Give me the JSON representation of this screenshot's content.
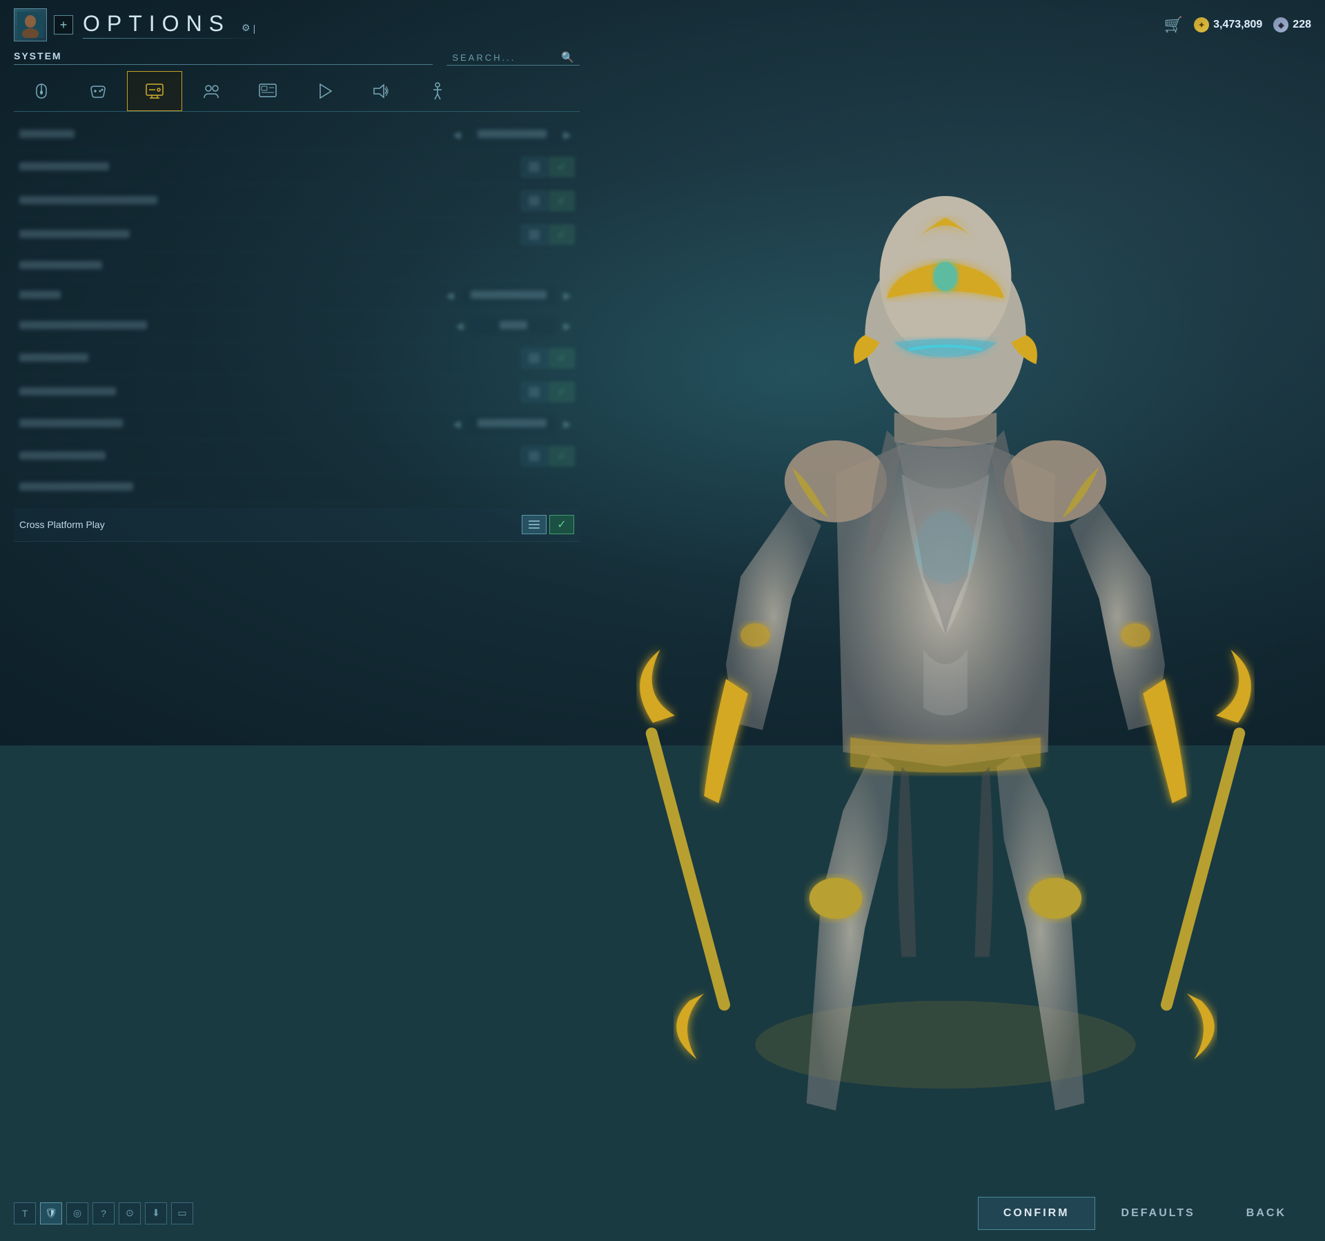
{
  "header": {
    "title": "OPTIONS",
    "add_label": "+",
    "currency1_amount": "3,473,809",
    "currency2_amount": "228"
  },
  "search": {
    "placeholder": "SEARCH..."
  },
  "section_label": "SYSTEM",
  "tabs": [
    {
      "id": "mouse",
      "icon": "🖱",
      "label": "Mouse"
    },
    {
      "id": "controller",
      "icon": "🎮",
      "label": "Controller"
    },
    {
      "id": "display",
      "icon": "⚙",
      "label": "Display",
      "active": true
    },
    {
      "id": "social",
      "icon": "👥",
      "label": "Social"
    },
    {
      "id": "interface",
      "icon": "🖥",
      "label": "Interface"
    },
    {
      "id": "gameplay",
      "icon": "▶",
      "label": "Gameplay"
    },
    {
      "id": "audio",
      "icon": "🔊",
      "label": "Audio"
    },
    {
      "id": "accessibility",
      "icon": "♿",
      "label": "Accessibility"
    }
  ],
  "settings": [
    {
      "id": "pc_type",
      "name": "PC Type",
      "type": "selector",
      "value": "XXXXXXXX",
      "blurred": true
    },
    {
      "id": "setting2",
      "name": "XXXXXXXXXX",
      "type": "toggle",
      "blurred": true
    },
    {
      "id": "setting3",
      "name": "XXXXXXXXXXXXXXXXXXXXXXXX",
      "type": "toggle",
      "blurred": true
    },
    {
      "id": "setting4",
      "name": "XXXXXXXXXXXXXXXXX",
      "type": "toggle",
      "blurred": true
    },
    {
      "id": "section1",
      "name": "— XXXXXXXX —",
      "type": "section",
      "blurred": true
    },
    {
      "id": "vsync",
      "name": "XXXXX",
      "type": "selector",
      "value": "XXXXXXXXXX",
      "blurred": true
    },
    {
      "id": "refresh",
      "name": "XXXXXXXXXXXXXXXXXXXXXXX",
      "type": "selector",
      "value": "XXX",
      "blurred": true
    },
    {
      "id": "setting7",
      "name": "XXXXXXXXXXX",
      "type": "toggle",
      "blurred": true
    },
    {
      "id": "setting8",
      "name": "XXXXXXXXXXXXXXXX",
      "type": "toggle",
      "blurred": true
    },
    {
      "id": "setting9",
      "name": "XXXXXXXXXXXXXXXXX",
      "type": "selector",
      "value": "XXXXXXXXXX",
      "blurred": true
    },
    {
      "id": "setting10",
      "name": "XXXXXXXXXXXXXX",
      "type": "toggle",
      "blurred": true
    },
    {
      "id": "setting11",
      "name": "XXXXXXXXXXXXXX",
      "type": "text",
      "blurred": true
    },
    {
      "id": "cross_platform",
      "name": "Cross Platform Play",
      "type": "toggle_checked",
      "blurred": false
    }
  ],
  "buttons": {
    "confirm": "CONFIRM",
    "defaults": "DEFAULTS",
    "back": "BACK"
  },
  "bottom_icons": [
    {
      "id": "icon1",
      "symbol": "T",
      "active": false
    },
    {
      "id": "icon2",
      "symbol": "🛡",
      "active": true
    },
    {
      "id": "icon3",
      "symbol": "◎",
      "active": false
    },
    {
      "id": "icon4",
      "symbol": "?",
      "active": false
    },
    {
      "id": "icon5",
      "symbol": "◉",
      "active": false
    },
    {
      "id": "icon6",
      "symbol": "⬇",
      "active": false
    },
    {
      "id": "icon7",
      "symbol": "▭",
      "active": false
    }
  ]
}
